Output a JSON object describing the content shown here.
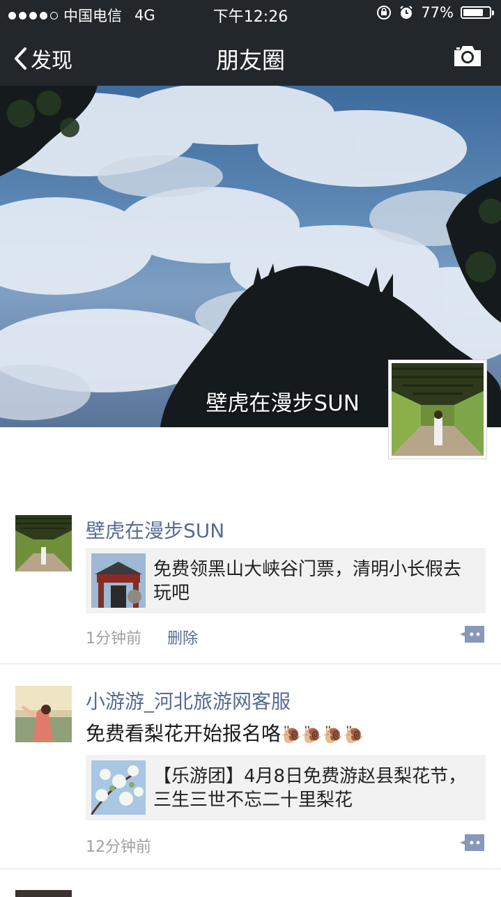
{
  "status_bar": {
    "carrier": "中国电信",
    "network": "4G",
    "time": "下午12:26",
    "battery": "77%",
    "battery_level": 0.77,
    "signal_bars_filled": 4,
    "signal_bars_total": 5
  },
  "nav": {
    "back_label": "发现",
    "title": "朋友圈",
    "camera_icon": "camera-icon"
  },
  "cover": {
    "user_name": "壁虎在漫步SUN"
  },
  "posts": [
    {
      "author": "壁虎在漫步SUN",
      "text": "",
      "link_title": "免费领黑山大峡谷门票，清明小长假去玩吧",
      "time": "1分钟前",
      "delete_label": "删除"
    },
    {
      "author": "小游游_河北旅游网客服",
      "text": "免费看梨花开始报名咯",
      "emoji": "🐌🐌🐌🐌",
      "link_title": "【乐游团】4月8日免费游赵县梨花节，三生三世不忘二十里梨花",
      "time": "12分钟前",
      "delete_label": ""
    }
  ],
  "colors": {
    "nav_bg": "#22272b",
    "author_link": "#576b95",
    "card_bg": "#f2f2f3"
  }
}
